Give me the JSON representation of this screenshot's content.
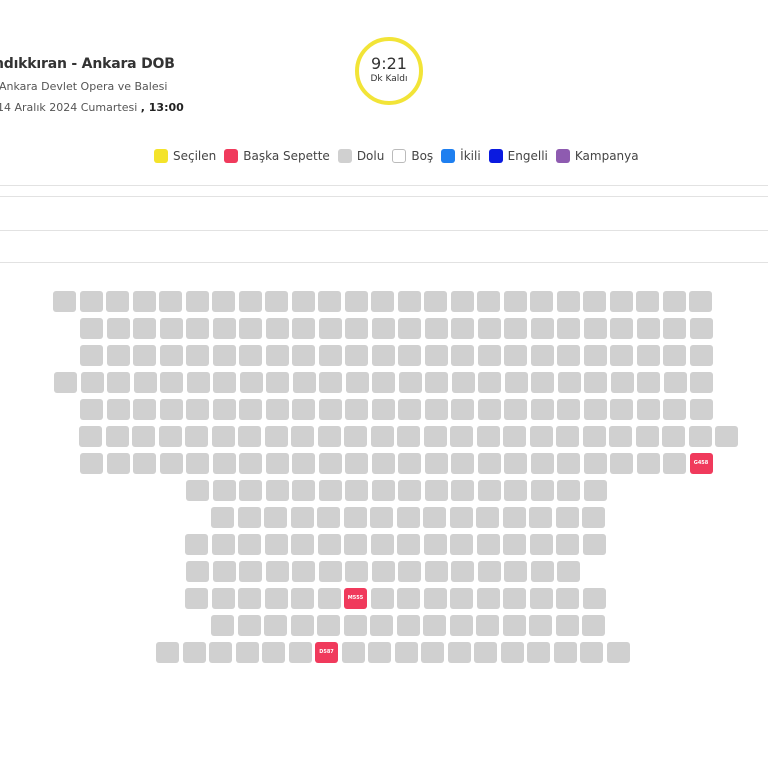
{
  "event": {
    "title": "ndıkkıran - Ankara DOB",
    "venue": "Ankara Devlet Opera ve Balesi",
    "date": "14 Aralık 2024 Cumartesi",
    "time": ", 13:00"
  },
  "timer": {
    "value": "9:21",
    "unit": "Dk Kaldı"
  },
  "legend": [
    {
      "label": "Seçilen",
      "color": "#f4e32a"
    },
    {
      "label": "Başka Sepette",
      "color": "#f03a5c"
    },
    {
      "label": "Dolu",
      "color": "#d0d0d0"
    },
    {
      "label": "Boş",
      "color": "#ffffff"
    },
    {
      "label": "İkili",
      "color": "#1e7ff0"
    },
    {
      "label": "Engelli",
      "color": "#0a1ae0"
    },
    {
      "label": "Kampanya",
      "color": "#8e5bb0"
    }
  ],
  "seats": {
    "status_legend": {
      "occupied": "Dolu",
      "in_other_basket": "Başka Sepette"
    },
    "rows": [
      {
        "count": 25,
        "highlight": {}
      },
      {
        "count": 24,
        "highlight": {}
      },
      {
        "count": 24,
        "highlight": {}
      },
      {
        "count": 25,
        "highlight": {}
      },
      {
        "count": 24,
        "highlight": {}
      },
      {
        "count": 25,
        "highlight": {}
      },
      {
        "count": 24,
        "highlight": {
          "23": "G458"
        }
      },
      {
        "count": 16,
        "highlight": {}
      },
      {
        "count": 15,
        "highlight": {}
      },
      {
        "count": 16,
        "highlight": {}
      },
      {
        "count": 15,
        "highlight": {}
      },
      {
        "count": 16,
        "highlight": {
          "6": "M555"
        }
      },
      {
        "count": 15,
        "highlight": {}
      },
      {
        "count": 18,
        "highlight": {
          "6": "D587"
        }
      }
    ]
  }
}
